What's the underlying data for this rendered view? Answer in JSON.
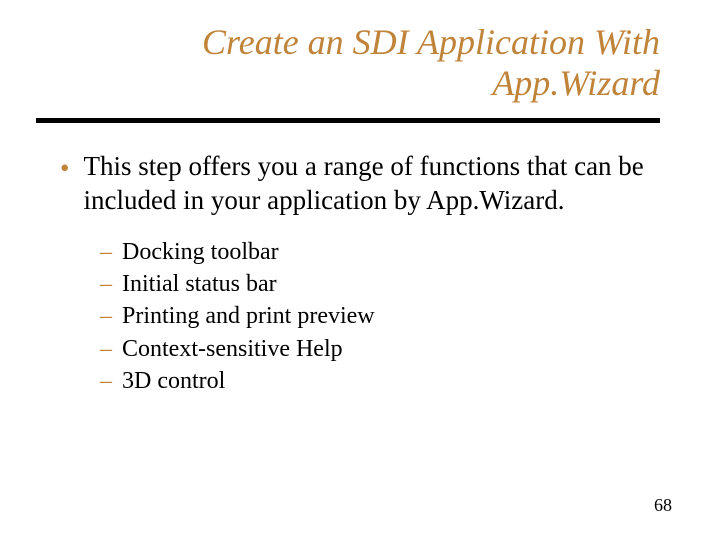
{
  "title_line1": "Create an SDI Application With",
  "title_line2": "App.Wizard",
  "bullet": "This step offers you a range of functions that can be included in your application by App.Wizard.",
  "sub_items": [
    "Docking toolbar",
    "Initial status bar",
    "Printing and print preview",
    "Context-sensitive Help",
    "3D control"
  ],
  "page_number": "68"
}
